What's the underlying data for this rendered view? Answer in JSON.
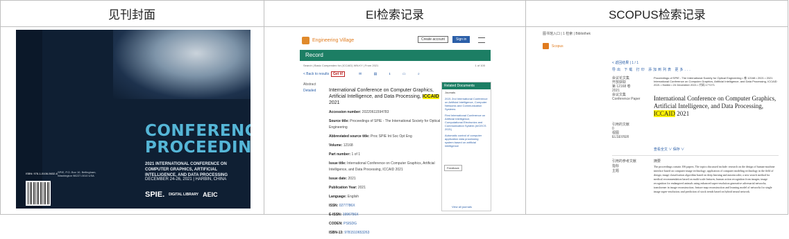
{
  "headers": [
    "见刊封面",
    "EI检索记录",
    "SCOPUS检索记录"
  ],
  "cover": {
    "title_line1": "CONFERENCE",
    "title_line2": "PROCEEDINGS",
    "subtitle": "2021 INTERNATIONAL CONFERENCE ON COMPUTER GRAPHICS, ARTIFICIAL INTELLIGENCE, AND DATA PROCESSING",
    "dates": "DECEMBER 24-26, 2021 | HARBIN, CHINA",
    "logo_spie": "SPIE.",
    "logo_dl": "DIGITAL LIBRARY",
    "logo_aeic": "AEIC",
    "isbn": "ISBN: 978-1-5106-5632-6",
    "back_text": "SPIE, P.O. Box 10, Bellingham, Washington 98227-0010 USA"
  },
  "ei": {
    "logo_text": "Engineering Village",
    "create_account": "Create account",
    "sign_in": "Sign in",
    "record_label": "Record",
    "crumb": "Search | Basic Compendex for (ICCAID) WN:KY | From 2021",
    "page_count": "1 of 100",
    "back": "< Back to results",
    "getit": "Get it!",
    "side_abstract": "Abstract",
    "side_detailed": "Detailed",
    "title_pre": "International Conference on Computer Graphics, Artificial Intelligence, and Data Processing,",
    "title_hl": "ICCAID",
    "title_year": "2021",
    "fields": [
      {
        "k": "Accession number:",
        "v": "20220611594783"
      },
      {
        "k": "Source title:",
        "v": "Proceedings of SPIE - The International Society for Optical Engineering"
      },
      {
        "k": "Abbreviated source title:",
        "v": "Proc SPIE Int Soc Opt Eng"
      },
      {
        "k": "Volume:",
        "v": "12168"
      },
      {
        "k": "Part number:",
        "v": "1 of 1"
      },
      {
        "k": "Issue title:",
        "v": "International Conference on Computer Graphics, Artificial Intelligence, and Data Processing, ICCAID 2021"
      },
      {
        "k": "Issue date:",
        "v": "2021"
      },
      {
        "k": "Publication Year:",
        "v": "2021"
      },
      {
        "k": "Language:",
        "v": "English"
      },
      {
        "k": "ISSN:",
        "v": "0277786X"
      },
      {
        "k": "E-ISSN:",
        "v": "1996756X"
      },
      {
        "k": "CODEN:",
        "v": "PSISDG"
      },
      {
        "k": "ISBN-13:",
        "v": "9781510653263"
      }
    ],
    "related_header": "Related Documents",
    "related_journals": "Journals",
    "related_items": [
      "2021 2nd International Conference on Artificial Intelligence, Computer Networks and Communication Systems",
      "First International Conference on Artificial Intelligence, Computational Electronics and Communication System (AICECS 2021)",
      "Automatic control of computer application data processing system based on artificial intelligence"
    ],
    "feedback": "Feedback",
    "view_all": "View all journals"
  },
  "scopus": {
    "top": "图书馆入口 | 1 检索 | Bibliothek",
    "logo_text": "Scopus",
    "nav": "< 返回结果 | 1 / 1",
    "tools": "导出 下载 打印 添加到列表 更多...",
    "meta": [
      "会议论文集",
      "开放获取",
      "第 12168 卷",
      "2021",
      "会议文集",
      "Conference Paper"
    ],
    "source": "Proceedings of SPIE - The International Society for Optical Engineering • 卷 12168 • 2021 • 2021 International Conference on Computer Graphics, Artificial Intelligence, and Data Processing, ICCAID 2021 • Harbin • 24 December 2021 • 代码 177271",
    "title_pre": "International Conference on Computer Graphics, Artificial Intelligence, and Data Processing,",
    "title_hl": "ICCAID",
    "title_year": "2021",
    "meta2": [
      "引用的文献",
      "0",
      "视图",
      "ELSEVIER"
    ],
    "ctrl": "查看全文 ∨  保存 ∨",
    "abstract_label": "摘要",
    "abstract_side": [
      "引用的参考文献",
      "指标",
      "主题"
    ],
    "abstract": "The proceedings contain 106 papers. The topics discussed include: research on the design of human-machine interface based on computer image technology; application of computer modeling technology in the field of design; image classification algorithm based on deep learning and autoencoder; a new search method for medical recommendation based on multi-scale features; human action recognition from images; image recognition for endangered animals using enhanced super-resolution generative adversarial networks; transformer in image reconstruction; feature map reconstruction and learning model of networks for single image super-resolution; and prediction of stock trends based on hybrid neural network."
  }
}
